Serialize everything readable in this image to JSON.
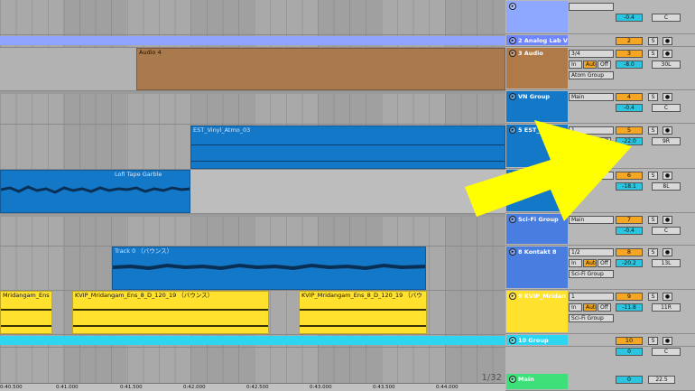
{
  "arrangement": {
    "page_indicator": "1/32",
    "ruler_ticks": [
      "0:40.500",
      "0:41.000",
      "0:41.500",
      "0:42.000",
      "0:42.500",
      "0:43.000",
      "0:43.500",
      "0:44.000"
    ],
    "clips": {
      "audio4": "Audio 4",
      "vinyl": "EST_Vinyl_Atmo_03",
      "lofi": "Lofi Tape Garble",
      "track0": "Track 0 （バウンス）",
      "mrid1": "Mridangam_Ens",
      "mrid2": "KVIP_Mridangam_Ens_8_D_120_19 （バウンス）",
      "mrid3": "KVIP_Mridangam_Ens_8_D_120_19 （バウ"
    }
  },
  "tracks": [
    {
      "name": "",
      "color": "#8fa8ff",
      "num": "",
      "vol": "-0.4",
      "pan": "C",
      "route": "",
      "mon": "",
      "in": ""
    },
    {
      "name": "2 Analog Lab V",
      "color": "#6f86ff",
      "num": "2",
      "vol": "",
      "pan": "",
      "route": "",
      "mon": "",
      "in": ""
    },
    {
      "name": "3 Audio",
      "color": "#b07a48",
      "num": "3",
      "vol": "-8.0",
      "pan": "30L",
      "route": "Atom Group",
      "mon": "3/4",
      "in": ""
    },
    {
      "name": "VN Group",
      "color": "#1478c8",
      "num": "4",
      "vol": "-0.4",
      "pan": "C",
      "route": "Main",
      "mon": "",
      "in": ""
    },
    {
      "name": "5 EST_Vinyl_A",
      "color": "#1478c8",
      "num": "5",
      "vol": "-22.0",
      "pan": "9R",
      "route": "",
      "mon": "1",
      "in": ""
    },
    {
      "name": "6 Lofi",
      "color": "#1478c8",
      "num": "6",
      "vol": "-18.1",
      "pan": "8L",
      "route": "VN Group",
      "mon": "",
      "in": ""
    },
    {
      "name": "Sci-Fi Group",
      "color": "#4a7de0",
      "num": "7",
      "vol": "-0.4",
      "pan": "C",
      "route": "Main",
      "mon": "",
      "in": ""
    },
    {
      "name": "8 Kontakt 8",
      "color": "#4a7de0",
      "num": "8",
      "vol": "-20.2",
      "pan": "13L",
      "route": "Sci-Fi Group",
      "mon": "1/2",
      "in": ""
    },
    {
      "name": "9 KVIP_Mridan",
      "color": "#ffe12e",
      "num": "9",
      "vol": "-11.8",
      "pan": "11R",
      "route": "Sci-Fi Group",
      "mon": "1",
      "in": ""
    },
    {
      "name": "10 Group",
      "color": "#2dd5f0",
      "num": "10",
      "vol": "0",
      "pan": "C",
      "route": "Main",
      "mon": "",
      "in": ""
    },
    {
      "name": "Main",
      "color": "#3ee07a",
      "num": "0",
      "vol": "22.5",
      "pan": "",
      "route": "",
      "mon": "1/2",
      "in": ""
    }
  ],
  "labels": {
    "in": "In",
    "auto": "Auto",
    "off": "Off",
    "solo": "S",
    "arm": "●"
  },
  "colors": {
    "arrow": "#ffff00",
    "clip_blue": "#1478c8",
    "clip_brown": "#a87a4e",
    "clip_yellow": "#ffe12e",
    "group_cyan": "#2dd5f0"
  }
}
